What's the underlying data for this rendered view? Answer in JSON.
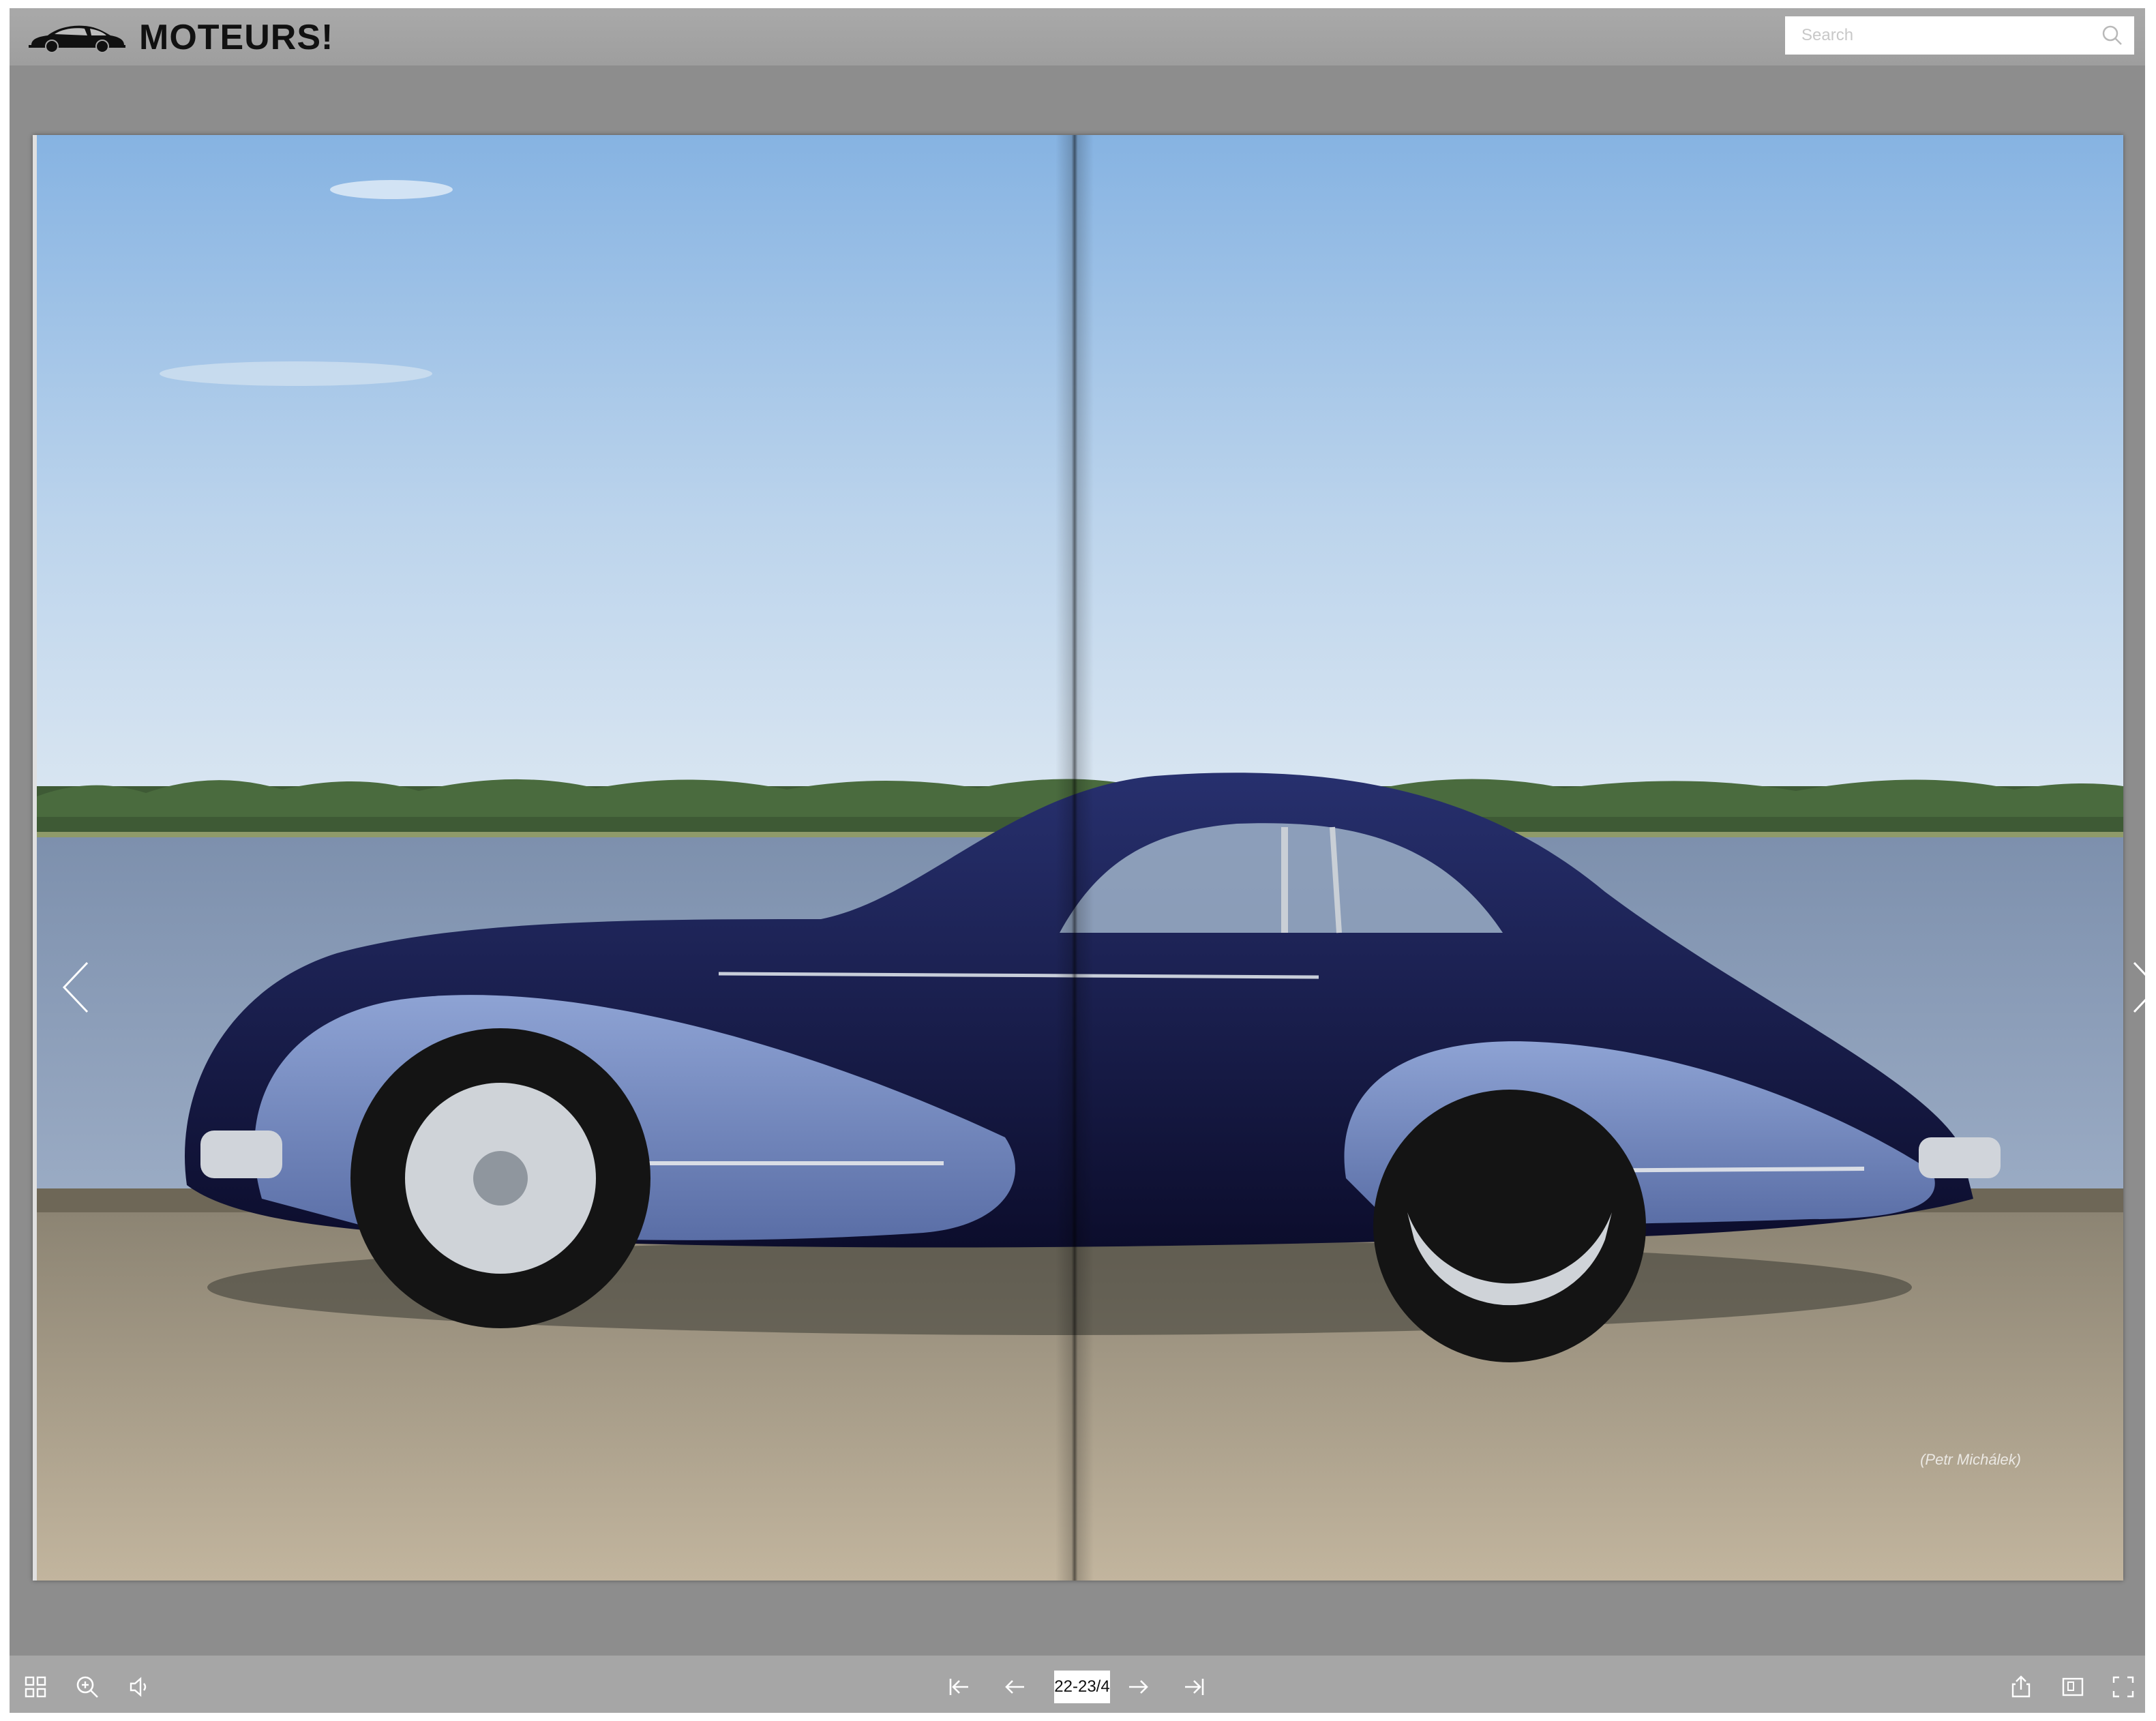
{
  "app": {
    "brand": "MOTEURS!",
    "logo_icon": "vintage-car-logo-icon"
  },
  "search": {
    "placeholder": "Search",
    "value": "",
    "icon": "search-icon"
  },
  "viewer": {
    "current_pages": "22-23/4",
    "photo_credit": "(Petr Michálek)",
    "prev_page_icon": "chevron-left-icon",
    "next_page_icon": "chevron-right-icon"
  },
  "toolbar": {
    "left": [
      "thumbnails-grid-icon",
      "zoom-in-icon",
      "sound-icon"
    ],
    "center": [
      "first-page-icon",
      "previous-page-icon",
      "next-page-icon",
      "last-page-icon"
    ],
    "right": [
      "share-icon",
      "toggle-layout-icon",
      "fullscreen-icon"
    ]
  },
  "colors": {
    "frame": "#8d8d8d",
    "topbar": "#a4a4a4",
    "bottombar": "#a6a6a6",
    "car_body": "#15174a",
    "car_fender": "#6f86bd"
  }
}
